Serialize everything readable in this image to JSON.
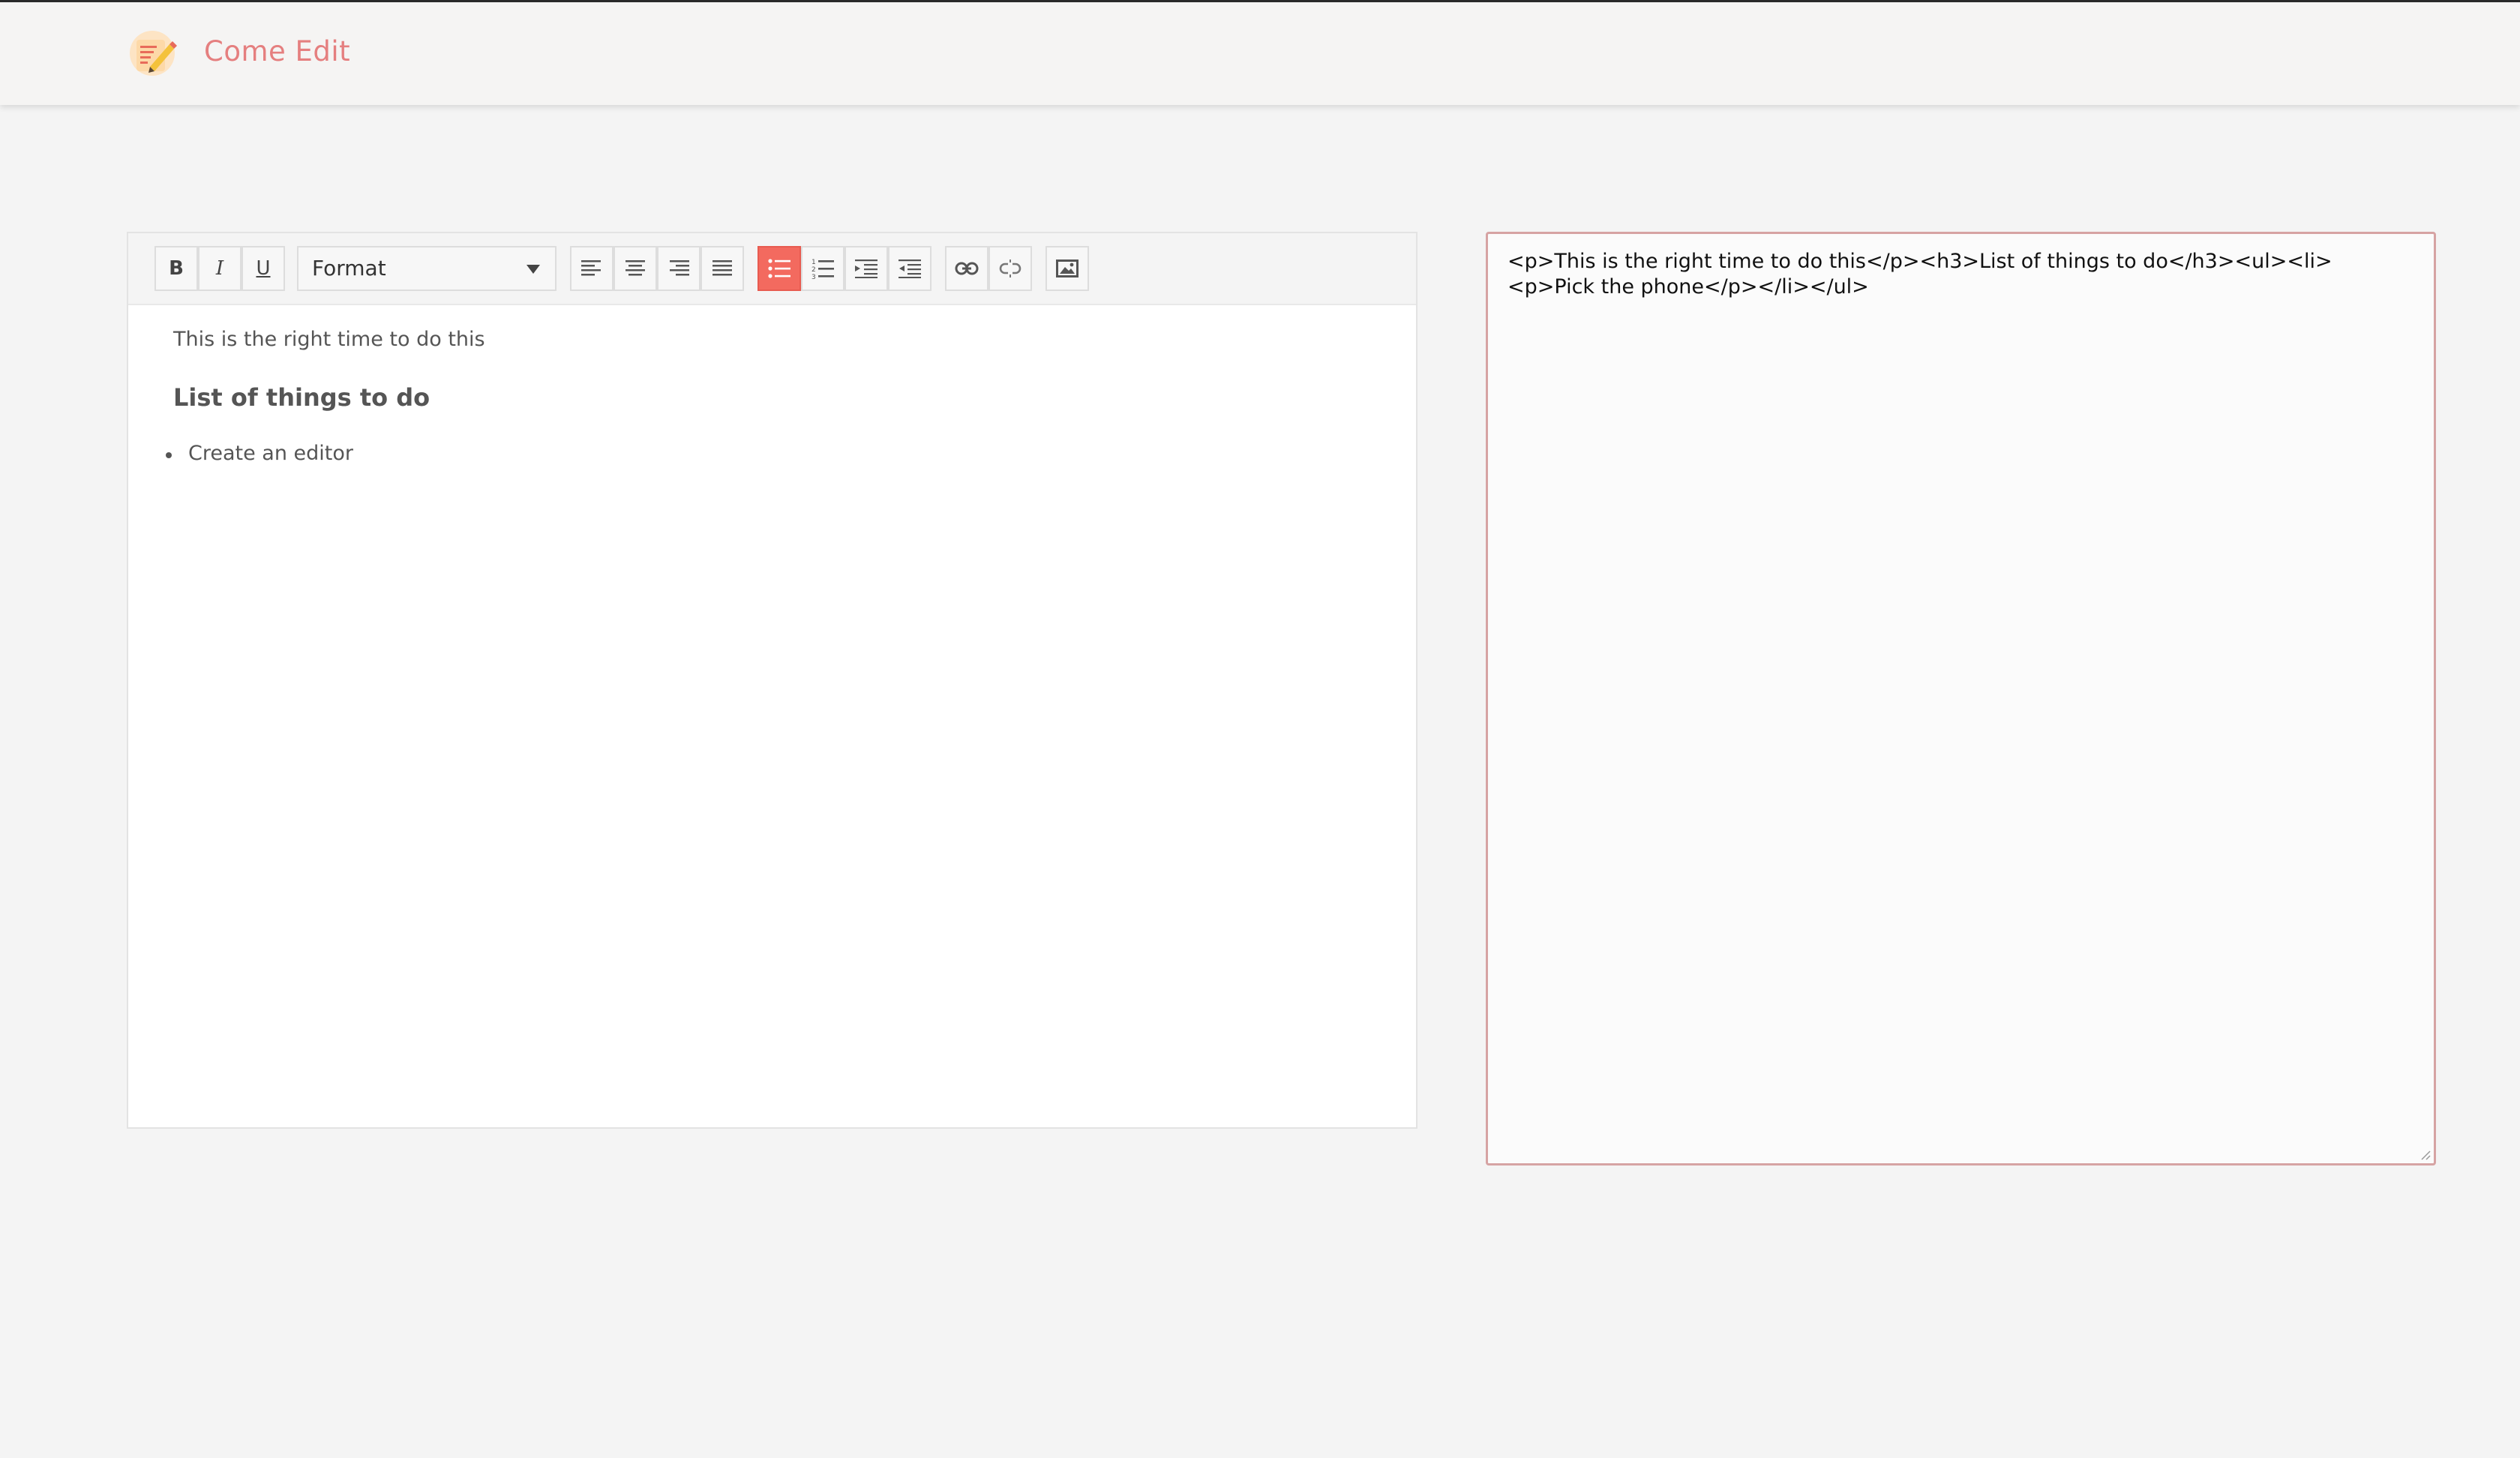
{
  "app": {
    "title": "Come Edit",
    "logo_icon": "notepad-pencil-icon"
  },
  "toolbar": {
    "bold_label": "B",
    "italic_label": "I",
    "underline_label": "U",
    "format_label": "Format",
    "buttons": [
      "bold",
      "italic",
      "underline",
      "format-dropdown",
      "align-left-icon",
      "align-center-icon",
      "align-right-icon",
      "align-justify-icon",
      "bullet-list-icon",
      "numbered-list-icon",
      "indent-icon",
      "outdent-icon",
      "link-icon",
      "unlink-icon",
      "image-icon"
    ],
    "active_button": "bullet-list-icon",
    "active_color": "#f36a5f"
  },
  "editor": {
    "paragraph": "This is the right time to do this",
    "heading": "List of things to do",
    "list_items": [
      "Create an editor"
    ]
  },
  "output": {
    "html": "<p>This is the right time to do this</p><h3>List of things to do</h3><ul><li><p>Pick the phone</p></li></ul>"
  },
  "colors": {
    "brand": "#e57f7f",
    "output_border": "#d6a3a3"
  }
}
